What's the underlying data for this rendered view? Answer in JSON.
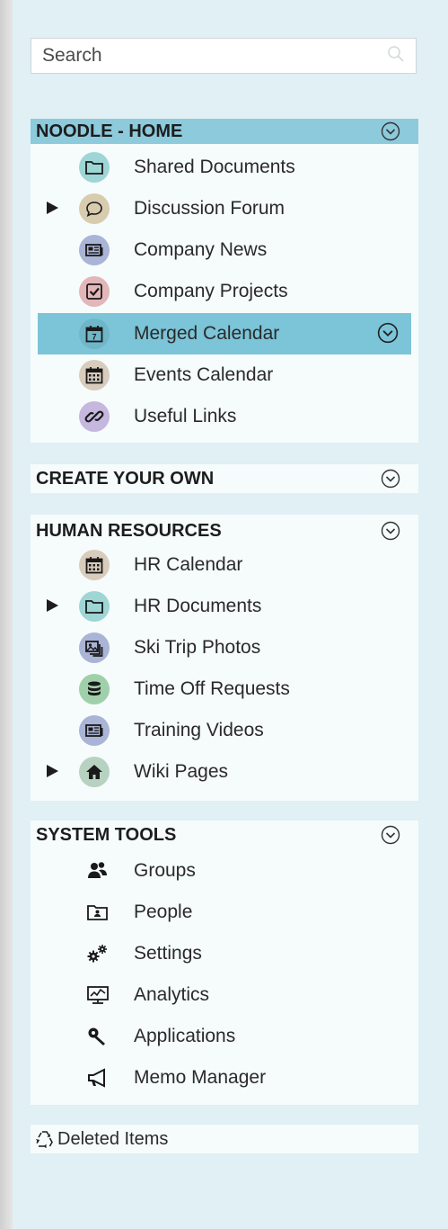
{
  "search": {
    "placeholder": "Search"
  },
  "sections": {
    "noodle_home": {
      "title": "NOODLE - HOME",
      "items": [
        {
          "label": "Shared Documents",
          "icon": "folder-icon",
          "color": "#9ed6d6"
        },
        {
          "label": "Discussion Forum",
          "icon": "speech-bubble-icon",
          "color": "#d8ccae",
          "expandable": true
        },
        {
          "label": "Company News",
          "icon": "newspaper-icon",
          "color": "#aab4d6"
        },
        {
          "label": "Company Projects",
          "icon": "checkbox-icon",
          "color": "#e3b6b9"
        },
        {
          "label": "Merged Calendar",
          "icon": "calendar-icon",
          "color": "#6fb6c8",
          "selected": true
        },
        {
          "label": "Events Calendar",
          "icon": "calendar-grid-icon",
          "color": "#d8ccbc"
        },
        {
          "label": "Useful Links",
          "icon": "link-icon",
          "color": "#c6b7de"
        }
      ]
    },
    "create_your_own": {
      "title": "CREATE YOUR OWN"
    },
    "human_resources": {
      "title": "HUMAN RESOURCES",
      "items": [
        {
          "label": "HR Calendar",
          "icon": "calendar-grid-icon",
          "color": "#d8ccbc"
        },
        {
          "label": "HR Documents",
          "icon": "folder-icon",
          "color": "#9ed6d6",
          "expandable": true
        },
        {
          "label": "Ski Trip Photos",
          "icon": "photos-icon",
          "color": "#aab4d6"
        },
        {
          "label": "Time Off Requests",
          "icon": "database-icon",
          "color": "#9fd0aa"
        },
        {
          "label": "Training Videos",
          "icon": "newspaper-icon",
          "color": "#aab4d6"
        },
        {
          "label": "Wiki Pages",
          "icon": "home-icon",
          "color": "#b8d2c2",
          "expandable": true
        }
      ]
    },
    "system_tools": {
      "title": "SYSTEM TOOLS",
      "items": [
        {
          "label": "Groups",
          "icon": "groups-icon"
        },
        {
          "label": "People",
          "icon": "person-card-icon"
        },
        {
          "label": "Settings",
          "icon": "gears-icon"
        },
        {
          "label": "Analytics",
          "icon": "analytics-monitor-icon"
        },
        {
          "label": "Applications",
          "icon": "wrench-icon"
        },
        {
          "label": "Memo Manager",
          "icon": "megaphone-icon"
        }
      ]
    }
  },
  "deleted_items": {
    "label": "Deleted Items",
    "icon": "recycle-icon"
  },
  "colors": {
    "sidebar_bg": "#e0f0f4",
    "panel_bg": "#f6fbfc",
    "header_active": "#8ccadc",
    "item_selected": "#7cc4d8"
  }
}
